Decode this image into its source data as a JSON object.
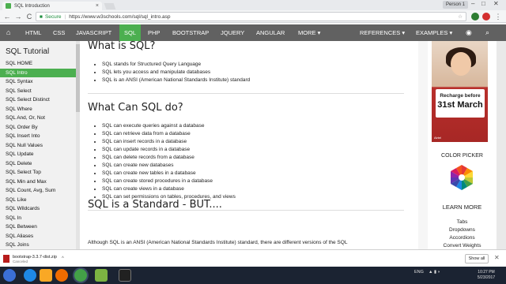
{
  "browser": {
    "tab_title": "SQL Introduction",
    "tab_close": "×",
    "profile": "Person 1",
    "win_min": "–",
    "win_max": "□",
    "win_close": "✕",
    "back": "←",
    "forward": "→",
    "reload": "C",
    "secure": "Secure",
    "url": "https://www.w3schools.com/sql/sql_intro.asp",
    "star": "☆"
  },
  "topnav": {
    "home_icon": "⌂",
    "items": [
      "HTML",
      "CSS",
      "JAVASCRIPT",
      "SQL",
      "PHP",
      "BOOTSTRAP",
      "JQUERY",
      "ANGULAR",
      "MORE ▾"
    ],
    "references": "REFERENCES ▾",
    "examples": "EXAMPLES ▾",
    "globe_icon": "◉",
    "search_icon": "⌕"
  },
  "sidebar": {
    "heading": "SQL Tutorial",
    "items": [
      "SQL HOME",
      "SQL Intro",
      "SQL Syntax",
      "SQL Select",
      "SQL Select Distinct",
      "SQL Where",
      "SQL And, Or, Not",
      "SQL Order By",
      "SQL Insert Into",
      "SQL Null Values",
      "SQL Update",
      "SQL Delete",
      "SQL Select Top",
      "SQL Min and Max",
      "SQL Count, Avg, Sum",
      "SQL Like",
      "SQL Wildcards",
      "SQL In",
      "SQL Between",
      "SQL Aliases",
      "SQL Joins"
    ]
  },
  "main": {
    "h_what": "What is SQL?",
    "what_items": [
      "SQL stands for Structured Query Language",
      "SQL lets you access and manipulate databases",
      "SQL is an ANSI (American National Standards Institute) standard"
    ],
    "h_can": "What Can SQL do?",
    "can_items": [
      "SQL can execute queries against a database",
      "SQL can retrieve data from a database",
      "SQL can insert records in a database",
      "SQL can update records in a database",
      "SQL can delete records from a database",
      "SQL can create new databases",
      "SQL can create new tables in a database",
      "SQL can create stored procedures in a database",
      "SQL can create views in a database",
      "SQL can set permissions on tables, procedures, and views"
    ],
    "h_standard": "SQL is a Standard - BUT....",
    "paragraph": "Although SQL is an ANSI (American National Standards Institute) standard, there are different versions of the SQL"
  },
  "right": {
    "ad_line1": "Recharge before",
    "ad_line2": "31st March",
    "ad_brand": "Airtel",
    "color_picker": "COLOR PICKER",
    "learn_more": "LEARN MORE",
    "links": [
      "Tabs",
      "Dropdowns",
      "Accordions",
      "Convert Weights"
    ]
  },
  "shelf": {
    "filename": "bootstrap-3.3.7-dist.zip",
    "status": "Canceled",
    "chevron": "^",
    "show_all": "Show all",
    "close": "✕"
  },
  "taskbar": {
    "lang": "ENG",
    "time": "10:27 PM",
    "date": "5/23/2017"
  }
}
